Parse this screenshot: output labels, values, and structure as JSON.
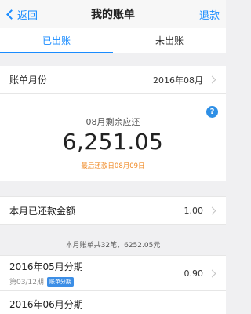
{
  "nav": {
    "back_label": "返回",
    "title": "我的账单",
    "refund_label": "退款"
  },
  "tabs": [
    {
      "label": "已出账",
      "active": true
    },
    {
      "label": "未出账",
      "active": false
    }
  ],
  "bill_month": {
    "label": "账单月份",
    "value": "2016年08月"
  },
  "summary": {
    "due_label": "08月剩余应还",
    "due_amount": "6,251.05",
    "due_date": "最后还款日08月09日",
    "help_symbol": "?"
  },
  "paid": {
    "label": "本月已还款金额",
    "value": "1.00"
  },
  "count_text": "本月账单共32笔，6252.05元",
  "installments": [
    {
      "title": "2016年05月分期",
      "period": "第03/12期",
      "tag": "账单分期",
      "amount": "0.90"
    },
    {
      "title": "2016年06月分期"
    }
  ],
  "colors": {
    "accent": "#1a8cff",
    "due_date": "#f08c2a",
    "background": "#f0f0f2"
  }
}
